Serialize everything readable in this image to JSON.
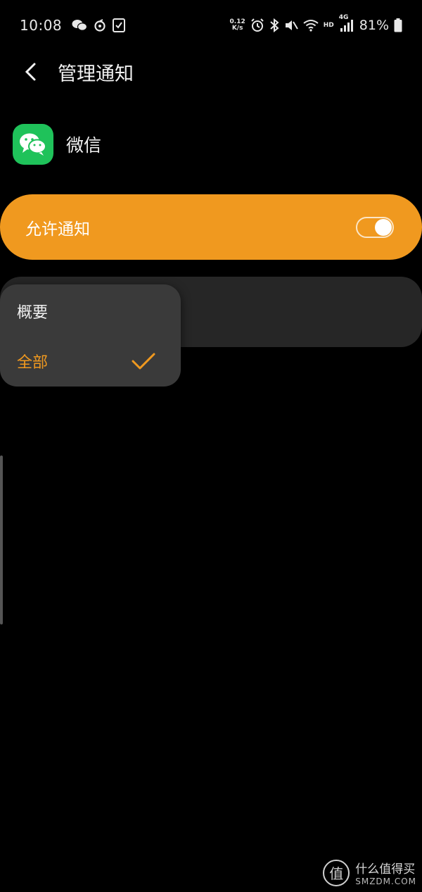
{
  "status_bar": {
    "time": "10:08",
    "net_speed_value": "0.12",
    "net_speed_unit": "K/s",
    "hd_label": "HD",
    "network_label": "4G",
    "battery_percent": "81%",
    "left_icons": [
      "wechat-icon",
      "netease-music-icon",
      "sim-toolkit-icon"
    ],
    "right_icons": [
      "alarm-icon",
      "bluetooth-icon",
      "mute-icon",
      "wifi-icon",
      "signal-icon",
      "battery-icon"
    ]
  },
  "header": {
    "title": "管理通知"
  },
  "app": {
    "name": "微信",
    "icon": "wechat-app-icon",
    "icon_color": "#1fc25a"
  },
  "allow_notifications": {
    "label": "允许通知",
    "enabled": true,
    "accent_color": "#f0991f"
  },
  "style_popup": {
    "options": [
      {
        "label": "概要",
        "selected": false
      },
      {
        "label": "全部",
        "selected": true
      }
    ]
  },
  "watermark": {
    "logo_char": "值",
    "cn": "什么值得买",
    "en": "SMZDM.COM"
  }
}
